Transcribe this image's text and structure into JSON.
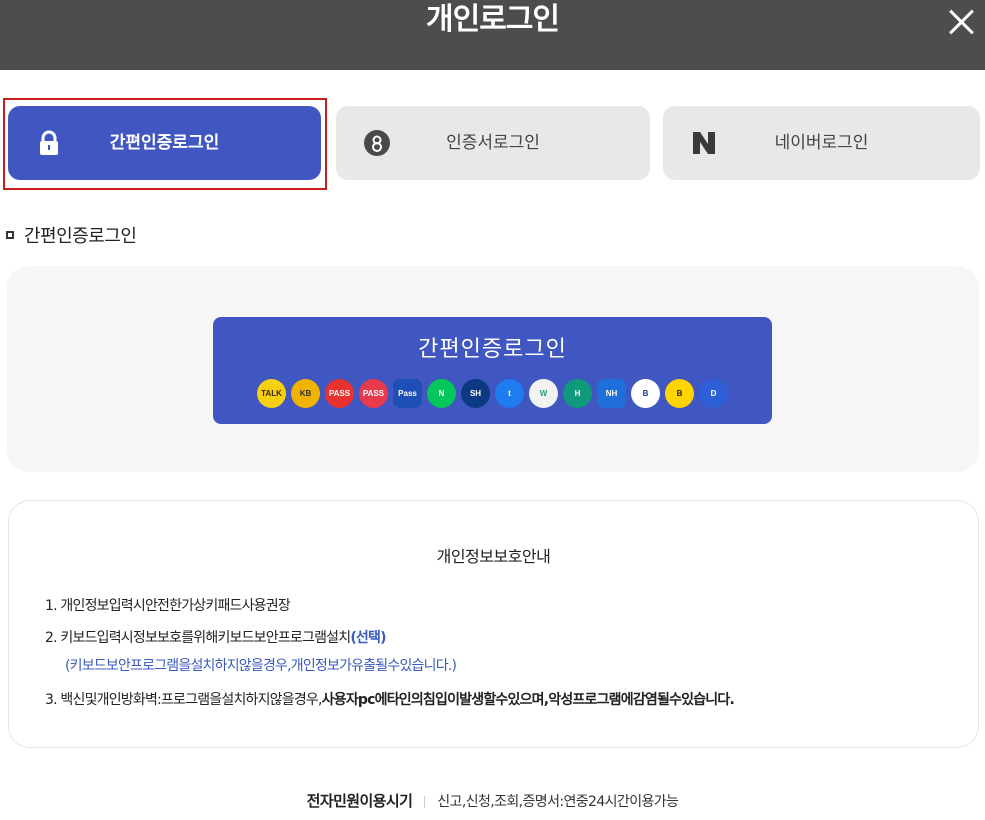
{
  "header": {
    "title": "개인로그인"
  },
  "tabs": [
    {
      "label": "간편인증로그인",
      "icon": "lock-icon",
      "active": true
    },
    {
      "label": "인증서로그인",
      "icon": "certificate-icon",
      "active": false
    },
    {
      "label": "네이버로그인",
      "icon": "naver-icon",
      "active": false
    }
  ],
  "section": {
    "heading": "간편인증로그인"
  },
  "easy_login": {
    "button_label": "간편인증로그인",
    "providers": [
      {
        "icon": "kakao-icon",
        "text": "TALK",
        "bg": "#f5d10f",
        "fg": "#3b1e1e"
      },
      {
        "icon": "kb-icon",
        "text": "KB",
        "bg": "#f0b400",
        "fg": "#333333"
      },
      {
        "icon": "samsung-pass-icon",
        "text": "PASS",
        "bg": "#e8322f",
        "fg": "#ffffff"
      },
      {
        "icon": "pass-icon",
        "text": "PASS",
        "bg": "#e83a4d",
        "fg": "#ffffff"
      },
      {
        "icon": "payco-icon",
        "text": "Pass",
        "bg": "#1d4fb6",
        "fg": "#ffffff"
      },
      {
        "icon": "naver-icon",
        "text": "N",
        "bg": "#03c75a",
        "fg": "#ffffff"
      },
      {
        "icon": "shinhan-icon",
        "text": "SH",
        "bg": "#0b3a82",
        "fg": "#ffffff"
      },
      {
        "icon": "toss-icon",
        "text": "t",
        "bg": "#1e7bf0",
        "fg": "#ffffff"
      },
      {
        "icon": "woori-icon",
        "text": "W",
        "bg": "#f2f2f2",
        "fg": "#2a9d6a"
      },
      {
        "icon": "hana-icon",
        "text": "H",
        "bg": "#0f9a7c",
        "fg": "#ffffff"
      },
      {
        "icon": "nh-icon",
        "text": "NH",
        "bg": "#1e6fd9",
        "fg": "#ffffff"
      },
      {
        "icon": "ibk-icon",
        "text": "B",
        "bg": "#ffffff",
        "fg": "#1d3f9a"
      },
      {
        "icon": "kbank-icon",
        "text": "B",
        "bg": "#ffd400",
        "fg": "#222222"
      },
      {
        "icon": "shield-icon",
        "text": "D",
        "bg": "#2f5fd8",
        "fg": "#ffffff"
      }
    ]
  },
  "notice": {
    "title": "개인정보보호안내",
    "item1": "1. 개인정보입력시안전한가상키패드사용권장",
    "item2_prefix": "2. 키보드입력시정보보호를위해키보드보안프로그램설치",
    "item2_link": "(선택)",
    "item2_sub": "(키보드보안프로그램을설치하지않을경우,개인정보가유출될수있습니다.)",
    "item3_prefix": "3. 백신및개인방화벽:프로그램을설치하지않을경우,",
    "item3_bold": "사용자pc에타인의침입이발생할수있으며,악성프로그램에감염될수있습니다."
  },
  "footer": {
    "label": "전자민원이용시기",
    "text": "신고,신청,조회,증명서:연중24시간이용가능"
  }
}
